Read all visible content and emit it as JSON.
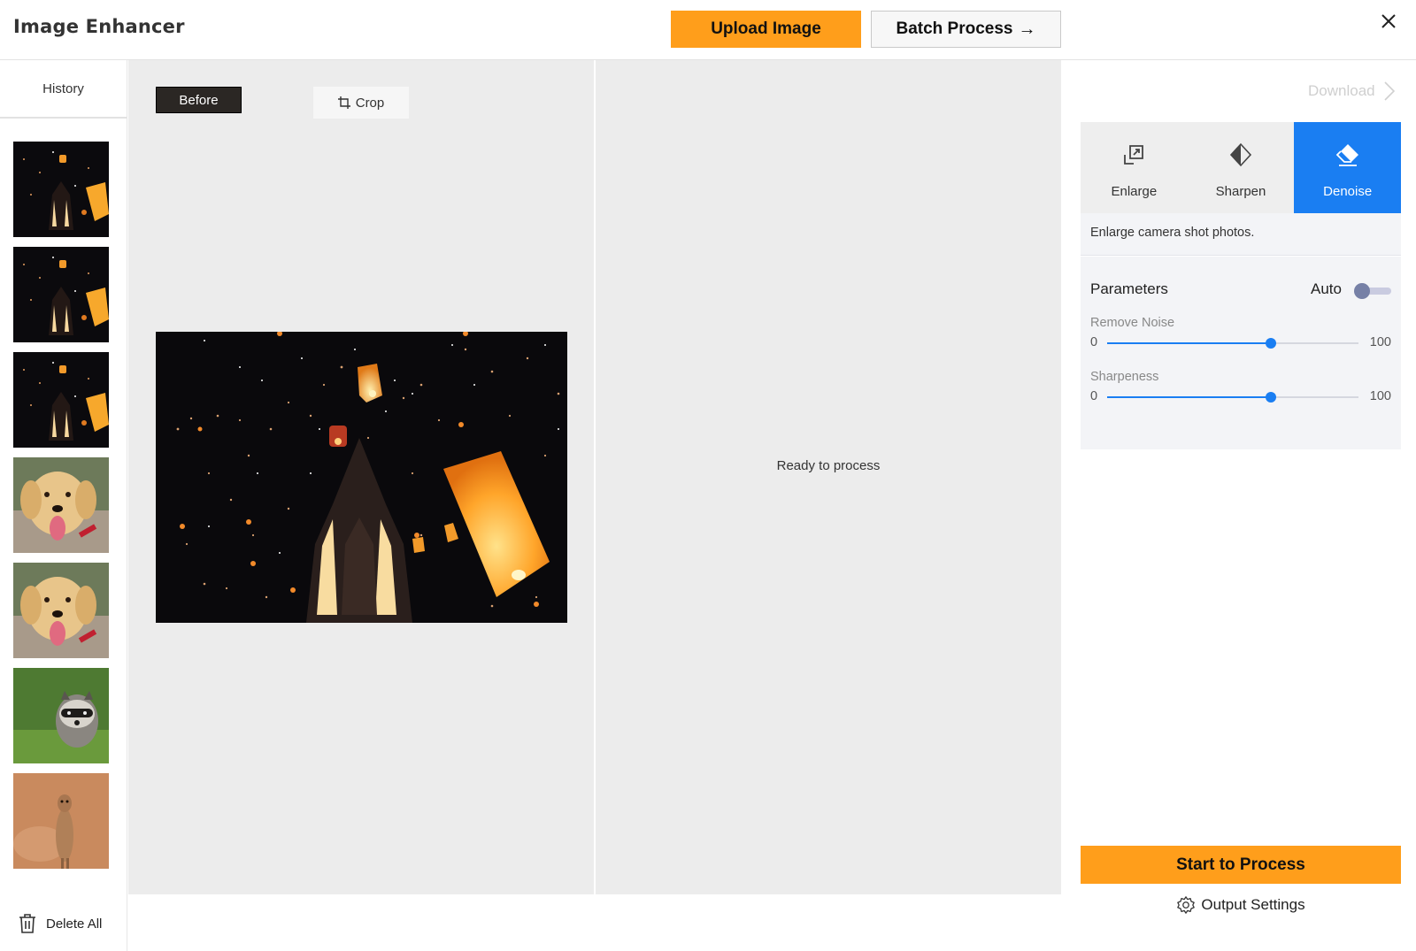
{
  "header": {
    "title": "Image Enhancer",
    "upload_label": "Upload Image",
    "batch_label": "Batch Process",
    "batch_arrow": "→"
  },
  "history": {
    "title": "History",
    "thumbnails": [
      {
        "subject": "sky-lanterns"
      },
      {
        "subject": "sky-lanterns"
      },
      {
        "subject": "sky-lanterns"
      },
      {
        "subject": "golden-retriever"
      },
      {
        "subject": "golden-retriever"
      },
      {
        "subject": "raccoon"
      },
      {
        "subject": "meerkat"
      }
    ],
    "delete_all_label": "Delete All"
  },
  "before_panel": {
    "badge": "Before",
    "crop_label": "Crop"
  },
  "after_panel": {
    "status": "Ready to process"
  },
  "right_panel": {
    "download_label": "Download",
    "tools": [
      {
        "label": "Enlarge",
        "icon": "enlarge-icon",
        "active": false
      },
      {
        "label": "Sharpen",
        "icon": "sharpen-icon",
        "active": false
      },
      {
        "label": "Denoise",
        "icon": "eraser-icon",
        "active": true
      }
    ],
    "description": "Enlarge camera shot photos.",
    "parameters_title": "Parameters",
    "auto_label": "Auto",
    "auto_enabled": false,
    "sliders": [
      {
        "label": "Remove Noise",
        "min": "0",
        "max": "100",
        "value": 65
      },
      {
        "label": "Sharpeness",
        "min": "0",
        "max": "100",
        "value": 65
      }
    ],
    "start_label": "Start to Process",
    "output_settings_label": "Output Settings"
  },
  "colors": {
    "accent_orange": "#ff9e1b",
    "accent_blue": "#1a7ef2"
  }
}
